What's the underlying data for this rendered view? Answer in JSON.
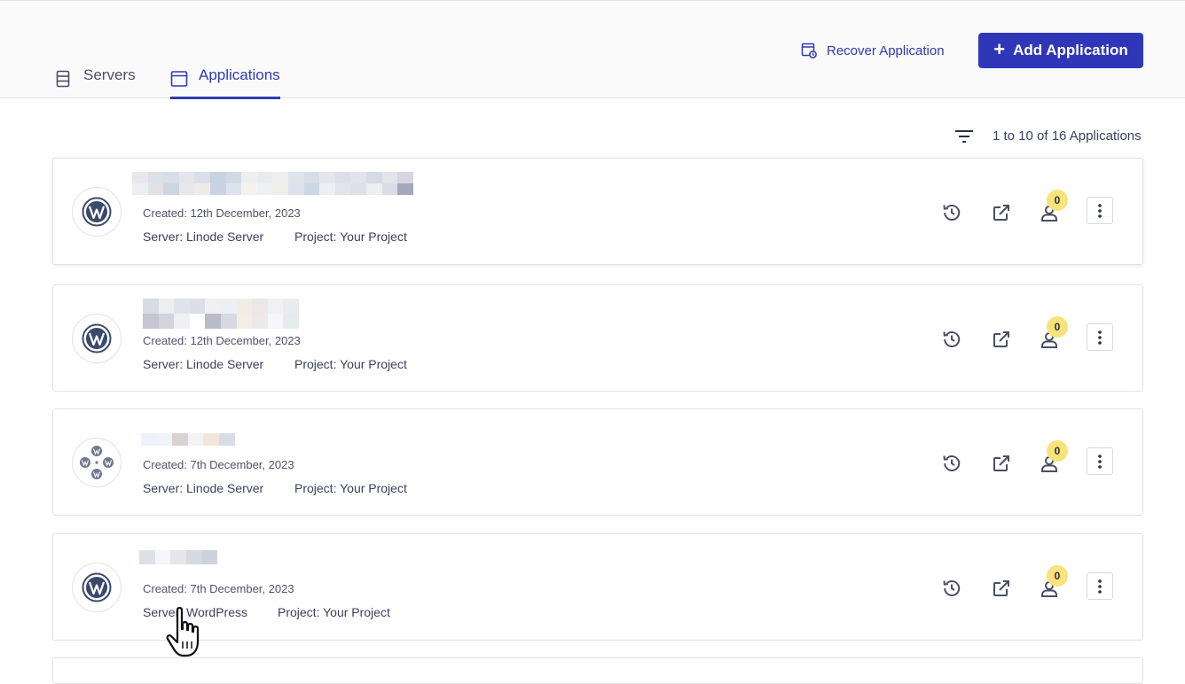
{
  "tabs": [
    {
      "label": "Servers",
      "icon": "server-icon",
      "active": false
    },
    {
      "label": "Applications",
      "icon": "window-icon",
      "active": true
    }
  ],
  "header": {
    "recover_label": "Recover Application",
    "add_label": "Add Application"
  },
  "list": {
    "count_text": "1 to 10 of 16 Applications"
  },
  "applications": [
    {
      "created": "Created: 12th December, 2023",
      "server": "Server: Linode Server",
      "project": "Project: Your Project",
      "badge": "0"
    },
    {
      "created": "Created: 12th December, 2023",
      "server": "Server: Linode Server",
      "project": "Project: Your Project",
      "badge": "0"
    },
    {
      "created": "Created: 7th December, 2023",
      "server": "Server: Linode Server",
      "project": "Project: Your Project",
      "badge": "0"
    },
    {
      "created": "Created: 7th December, 2023",
      "server": "Server: WordPress",
      "project": "Project: Your Project",
      "badge": "0"
    }
  ],
  "colors": {
    "accent": "#2f37b8",
    "badge": "#f8e37a"
  }
}
